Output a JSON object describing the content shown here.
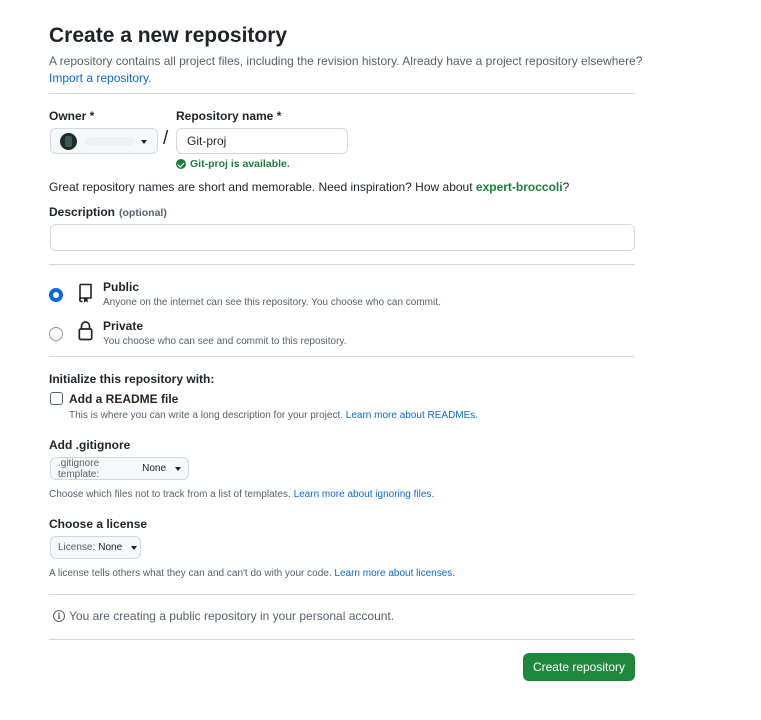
{
  "page": {
    "title": "Create a new repository",
    "intro_text": "A repository contains all project files, including the revision history. Already have a project repository elsewhere?",
    "import_link": "Import a repository."
  },
  "owner": {
    "label": "Owner *"
  },
  "separator": "/",
  "repo_name": {
    "label": "Repository name *",
    "value": "Git-proj",
    "availability": "Git-proj is available."
  },
  "hint": {
    "text": "Great repository names are short and memorable. Need inspiration? How about",
    "suggestion": "expert-broccoli",
    "suffix": "?"
  },
  "description": {
    "label": "Description",
    "optional": "(optional)",
    "value": ""
  },
  "visibility": {
    "public": {
      "title": "Public",
      "desc": "Anyone on the internet can see this repository. You choose who can commit.",
      "checked": true
    },
    "private": {
      "title": "Private",
      "desc": "You choose who can see and commit to this repository.",
      "checked": false
    }
  },
  "initialize": {
    "heading": "Initialize this repository with:",
    "readme_label": "Add a README file",
    "readme_desc": "This is where you can write a long description for your project.",
    "readme_link": "Learn more about READMEs."
  },
  "gitignore": {
    "heading": "Add .gitignore",
    "select_prefix": ".gitignore template:",
    "select_value": "None",
    "desc": "Choose which files not to track from a list of templates.",
    "link": "Learn more about ignoring files."
  },
  "license": {
    "heading": "Choose a license",
    "select_prefix": "License:",
    "select_value": "None",
    "desc": "A license tells others what they can and can't do with your code.",
    "link": "Learn more about licenses."
  },
  "notice": {
    "icon_glyph": "i",
    "text": "You are creating a public repository in your personal account."
  },
  "submit": {
    "label": "Create repository"
  },
  "colors": {
    "primary_button": "#1f883d",
    "link": "#0969da",
    "success": "#1a7f37",
    "border": "#d0d7de"
  }
}
